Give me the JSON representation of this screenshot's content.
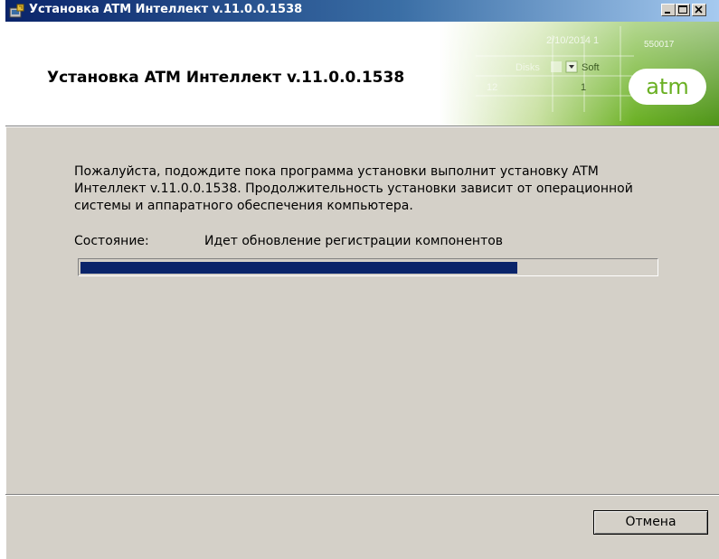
{
  "window": {
    "title": "Установка ATM Интеллект v.11.0.0.1538"
  },
  "header": {
    "title": "Установка ATM Интеллект v.11.0.0.1538",
    "logo_text": "atm",
    "art_texts": [
      "2/10/2014 1",
      "550017",
      "Disks",
      "Soft",
      "12",
      "1"
    ]
  },
  "body": {
    "message": "Пожалуйста, подождите пока программа установки выполнит установку ATM Интеллект v.11.0.0.1538. Продолжительность установки зависит от операционной системы и аппаратного обеспечения компьютера.",
    "status_label": "Состояние:",
    "status_value": "Идет обновление регистрации компонентов",
    "progress_fraction": 0.76
  },
  "footer": {
    "cancel_label": "Отмена"
  },
  "colors": {
    "dialog_bg": "#d4d0c8",
    "progress_fill": "#0a246a",
    "logo_green": "#6ab023",
    "titlebar_start": "#0a246a",
    "titlebar_end": "#a6caf0"
  },
  "icons": {
    "title": "installer-icon",
    "minimize": "minimize-icon",
    "maximize": "maximize-icon",
    "close": "close-icon"
  }
}
